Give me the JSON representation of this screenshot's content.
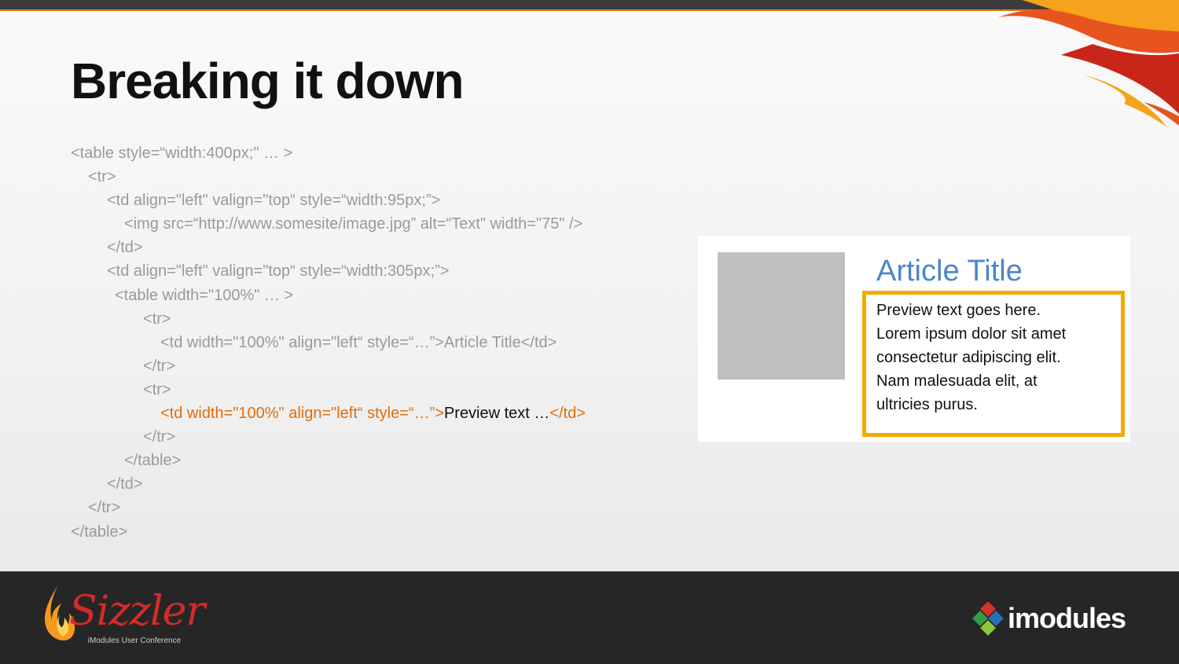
{
  "slide": {
    "title": "Breaking it down"
  },
  "code_lines": [
    {
      "indent": 0,
      "text": "<table style=“width:400px;\" … >"
    },
    {
      "indent": 22,
      "text": "<tr>"
    },
    {
      "indent": 46,
      "text": "<td align=\"left\" valign=\"top“ style=“width:95px;”>"
    },
    {
      "indent": 68,
      "text": "<img src=“http://www.somesite/image.jpg” alt=“Text\" width=\"75\" />"
    },
    {
      "indent": 46,
      "text": "</td>"
    },
    {
      "indent": 46,
      "text": "<td align=\"left\" valign=\"top“ style=“width:305px;”>"
    },
    {
      "indent": 56,
      "text": "<table width=\"100%\" … >"
    },
    {
      "indent": 92,
      "text": "<tr>"
    },
    {
      "indent": 114,
      "text": "<td width=\"100%\" align=\"left“ style=“…”>Article Title</td>"
    },
    {
      "indent": 92,
      "text": "</tr>"
    },
    {
      "indent": 92,
      "text": "<tr>"
    },
    {
      "indent": 114,
      "highlight": true,
      "open": "<td width=\"100%\" align=\"left“ style=“…”>",
      "inner": "Preview text …",
      "close": "</td>"
    },
    {
      "indent": 92,
      "text": "</tr>"
    },
    {
      "indent": 68,
      "text": "</table>"
    },
    {
      "indent": 46,
      "text": "</td>"
    },
    {
      "indent": 22,
      "text": "</tr>"
    },
    {
      "indent": 0,
      "text": "</table>"
    }
  ],
  "preview": {
    "title": "Article Title",
    "text_lines": [
      "Preview text goes here.",
      "Lorem ipsum dolor sit amet",
      "consectetur adipiscing elit.",
      "Nam malesuada elit, at",
      "ultricies purus."
    ]
  },
  "footer": {
    "sizzler_wordmark": "Sizzler",
    "sizzler_subtitle": "iModules User Conference",
    "imodules_wordmark": "imodules"
  },
  "colors": {
    "code_gray": "#9a9a9a",
    "highlight_orange": "#e36c0a",
    "preview_title_blue": "#4a86c8",
    "highlight_box": "#f2ab00",
    "image_placeholder": "#bfbfbf",
    "footer_bg": "#262626"
  }
}
